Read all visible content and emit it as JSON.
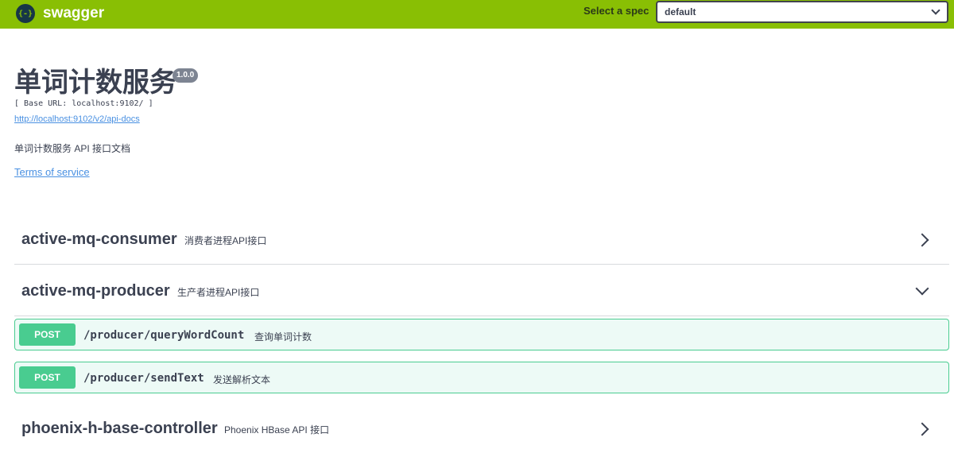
{
  "header": {
    "logo_icon": "{-}",
    "logo_text": "swagger",
    "spec_label": "Select a spec",
    "spec_value": "default"
  },
  "info": {
    "title": "单词计数服务",
    "version": "1.0.0",
    "base_url": "[ Base URL: localhost:9102/ ]",
    "api_docs_link": "http://localhost:9102/v2/api-docs",
    "description": "单词计数服务 API 接口文档",
    "terms": "Terms of service"
  },
  "tags": [
    {
      "name": "active-mq-consumer",
      "description": "消费者进程API接口",
      "expanded": false
    },
    {
      "name": "active-mq-producer",
      "description": "生产者进程API接口",
      "expanded": true,
      "operations": [
        {
          "method": "POST",
          "path": "/producer/queryWordCount",
          "summary": "查询单词计数"
        },
        {
          "method": "POST",
          "path": "/producer/sendText",
          "summary": "发送解析文本"
        }
      ]
    },
    {
      "name": "phoenix-h-base-controller",
      "description": "Phoenix HBase API 接口",
      "expanded": false
    }
  ],
  "colors": {
    "topbar": "#89bf04",
    "post": "#49cc90",
    "link": "#4990e2"
  }
}
